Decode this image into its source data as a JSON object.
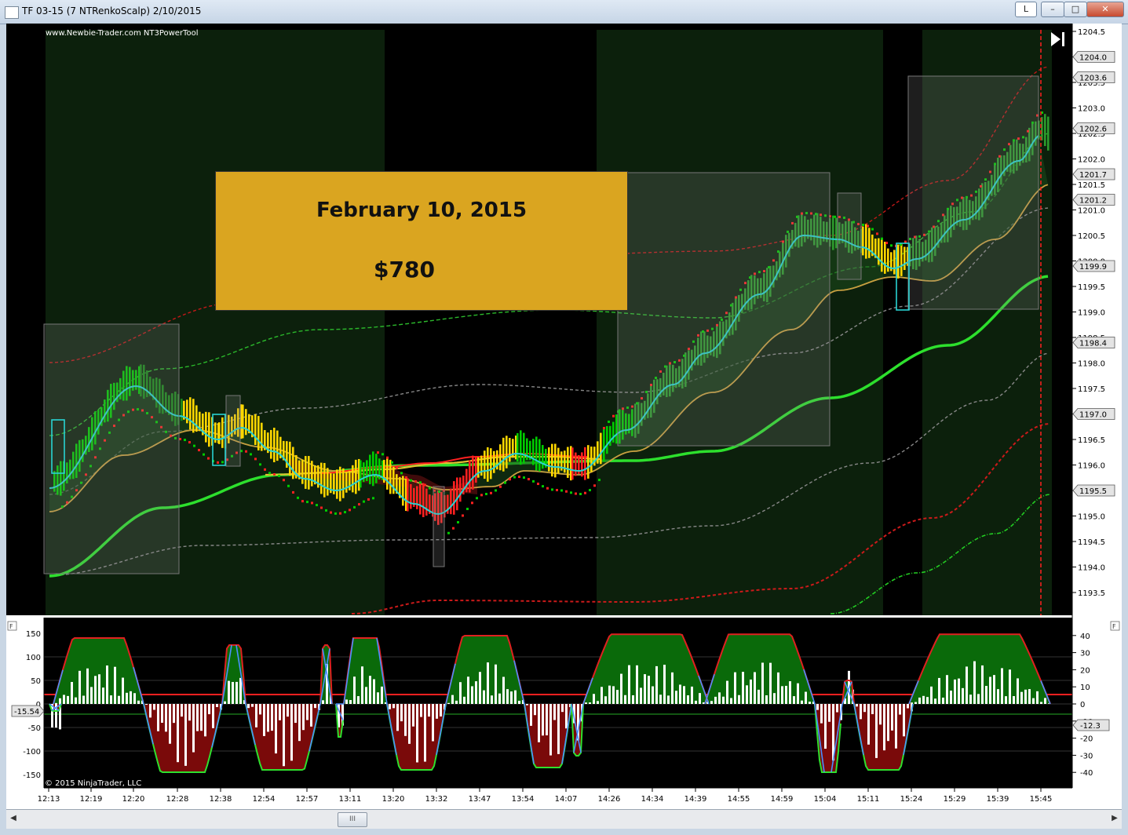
{
  "window": {
    "title": "TF 03-15 (7 NTRenkoScalp)  2/10/2015",
    "button_l": "L",
    "button_min": "–",
    "button_max": "□",
    "button_close": "✕"
  },
  "chart": {
    "watermark": "www.Newbie-Trader.com NT3PowerTool",
    "copyright": "© 2015 NinjaTrader, LLC",
    "panel_f_label": "F",
    "play_icon": "skip-forward-icon",
    "price_ticks": [
      "1204.5",
      "1204.0",
      "1203.5",
      "1203.0",
      "1202.5",
      "1202.0",
      "1201.5",
      "1201.0",
      "1200.5",
      "1200.0",
      "1199.5",
      "1199.0",
      "1198.5",
      "1198.0",
      "1197.5",
      "1197.0",
      "1196.5",
      "1196.0",
      "1195.5",
      "1195.0",
      "1194.5",
      "1194.0",
      "1193.5"
    ],
    "price_badges": [
      "1204.0",
      "1203.6",
      "1202.6",
      "1201.7",
      "1201.2",
      "1199.9",
      "1198.4",
      "1197.0",
      "1195.5"
    ],
    "osc_left_ticks": [
      "150",
      "100",
      "50",
      "0",
      "-50",
      "-100",
      "-150"
    ],
    "osc_right_ticks": [
      "40",
      "30",
      "20",
      "10",
      "0",
      "-10",
      "-20",
      "-30",
      "-40"
    ],
    "osc_left_badge": "-15.54",
    "osc_right_badge": "-12.3",
    "time_labels": [
      "12:13",
      "12:19",
      "12:20",
      "12:28",
      "12:38",
      "12:54",
      "12:57",
      "13:11",
      "13:20",
      "13:32",
      "13:47",
      "13:54",
      "14:07",
      "14:26",
      "14:34",
      "14:39",
      "14:55",
      "14:59",
      "15:04",
      "15:11",
      "15:24",
      "15:29",
      "15:39",
      "15:45"
    ],
    "colors": {
      "bg": "#000000",
      "session": "#0c200c",
      "up": "#00cc00",
      "down": "#ff2020",
      "yellow": "#ffd700",
      "cyan": "#29d3d3",
      "gold": "#c8a040",
      "ema": "#2de02d"
    }
  },
  "banner": {
    "date": "February 10, 2015",
    "amount": "$780",
    "bg": "#daa520"
  },
  "scrollbar": {
    "thumb_label": "III",
    "left_arrow": "◀",
    "right_arrow": "▶"
  }
}
